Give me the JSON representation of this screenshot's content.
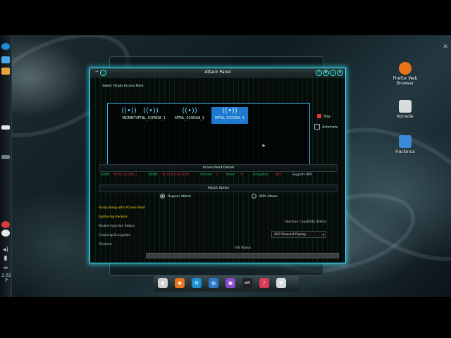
{
  "window": {
    "title": "Attack Panel",
    "controls": [
      "?",
      "⚙",
      "–",
      "□",
      "✕"
    ]
  },
  "select_target": {
    "label": "Select Target Access Point"
  },
  "access_points": [
    {
      "name": "MGMNT",
      "selected": false
    },
    {
      "name": "MTNL_01F6D8_1",
      "selected": false
    },
    {
      "name": "MTNL_029DA8_1",
      "selected": false
    },
    {
      "name": "MTNL_0333DA_1",
      "selected": true
    }
  ],
  "scan_controls": {
    "stop_label": "Stop",
    "automate_label": "Automate"
  },
  "details": {
    "header": "Access Point Details",
    "essid_key": "ESSID:",
    "essid_val": "MTNL_0333DA_1",
    "bssid_key": "BSSID:",
    "bssid_val": "01:02:ED:33:33:DA",
    "channel_key": "Channel:",
    "channel_val": "1",
    "power_key": "Power:",
    "power_val": "-72",
    "encryption_key": "Encryption:",
    "encryption_val": "WEP",
    "wps_text": "Supports WPS"
  },
  "attack_option": {
    "header": "Attack Option",
    "regular": "Regular Attack",
    "wps": "WPS  Attack",
    "selected": "regular"
  },
  "status_steps": [
    {
      "label": "Associating with Access Point",
      "state": "done"
    },
    {
      "label": "Gathering Packets",
      "state": "done"
    },
    {
      "label": "Packet Injection Status",
      "state": "todo"
    },
    {
      "label": "Cracking Encryption",
      "state": "todo"
    },
    {
      "label": "Finished",
      "state": "todo"
    }
  ],
  "injection": {
    "label": "Injection Capability Status",
    "selected": "ARP Request Replay"
  },
  "ivs": {
    "label": "IVS Status",
    "progress": 0.0
  },
  "desktop": {
    "icons": [
      {
        "label": "Firefox Web Browser",
        "color": "#e8741a"
      },
      {
        "label": "Konsole",
        "color": "#d8dcdc"
      },
      {
        "label": "Hackinux",
        "color": "#3a8ad8"
      }
    ]
  },
  "panel_left": {
    "clock": "2:32 P"
  },
  "dock": {
    "items": [
      {
        "name": "files-icon",
        "color": "#cfd2d0",
        "glyph": "▮"
      },
      {
        "name": "firefox-icon",
        "color": "#e8741a",
        "glyph": "◉"
      },
      {
        "name": "network-icon",
        "color": "#1b8fd1",
        "glyph": "⚙"
      },
      {
        "name": "globe-icon",
        "color": "#2a78c8",
        "glyph": "◍"
      },
      {
        "name": "terminal-icon",
        "color": "#8a4ad0",
        "glyph": "▣"
      },
      {
        "name": "wifi-icon",
        "color": "#202020",
        "glyph": "wifi"
      },
      {
        "name": "media-icon",
        "color": "#d83a5a",
        "glyph": "♪"
      },
      {
        "name": "tools-icon",
        "color": "#d8dcdc",
        "glyph": "✚"
      }
    ]
  }
}
